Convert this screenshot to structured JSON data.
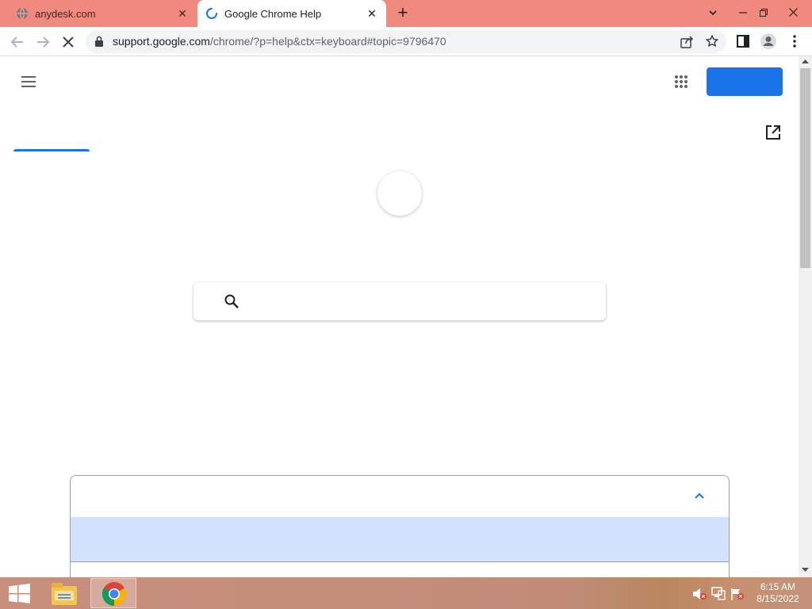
{
  "tabs": [
    {
      "title": "anydesk.com",
      "state": "inactive"
    },
    {
      "title": "Google Chrome Help",
      "state": "active-loading"
    }
  ],
  "address_bar": {
    "host": "support.google.com",
    "path": "/chrome/?p=help&ctx=keyboard#topic=9796470"
  },
  "taskbar": {
    "time": "6:15 AM",
    "date": "8/15/2022"
  },
  "colors": {
    "tabstrip": "#f08a7e",
    "accent": "#1a73e8",
    "highlight_row": "#d3e3fd"
  },
  "icons": [
    "menu-icon",
    "apps-grid-icon",
    "open-in-new-icon",
    "search-icon",
    "chevron-up-icon",
    "back-icon",
    "forward-icon",
    "stop-icon",
    "lock-icon",
    "share-icon",
    "star-icon",
    "side-panel-icon",
    "profile-icon",
    "kebab-menu-icon"
  ]
}
